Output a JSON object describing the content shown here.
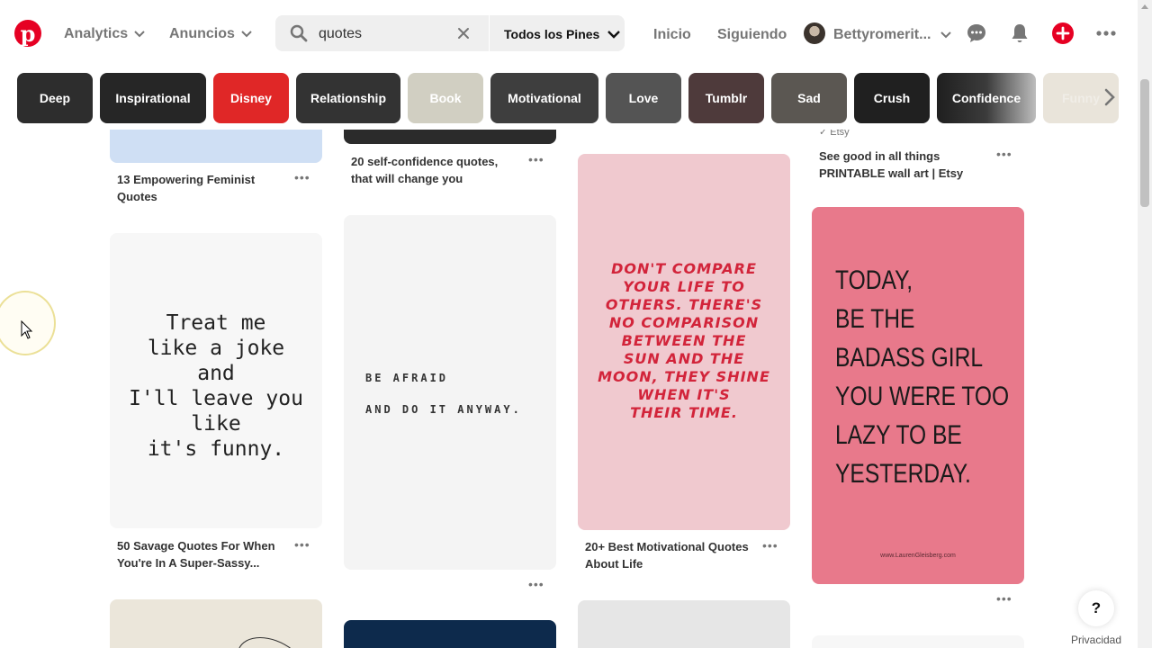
{
  "header": {
    "nav": [
      {
        "label": "Analytics"
      },
      {
        "label": "Anuncios"
      }
    ],
    "search": {
      "query": "quotes",
      "filter": "Todos los Pines"
    },
    "links": [
      {
        "label": "Inicio"
      },
      {
        "label": "Siguiendo"
      }
    ],
    "user": {
      "name": "Bettyromerit..."
    },
    "brand_color": "#e60023"
  },
  "chips": [
    {
      "label": "Deep",
      "color": "#2d2d2d"
    },
    {
      "label": "Inspirational",
      "color": "#262626"
    },
    {
      "label": "Disney",
      "color": "#e02727"
    },
    {
      "label": "Relationship",
      "color": "#333333"
    },
    {
      "label": "Book",
      "color": "#d1cfc2"
    },
    {
      "label": "Motivational",
      "color": "#3e3e3e"
    },
    {
      "label": "Love",
      "color": "#545454"
    },
    {
      "label": "Tumblr",
      "color": "#4e3a3b"
    },
    {
      "label": "Sad",
      "color": "#5b5752"
    },
    {
      "label": "Crush",
      "color": "#202020"
    },
    {
      "label": "Confidence",
      "color": "#3a3a3a"
    },
    {
      "label": "Funny",
      "color": "#e9e4da"
    }
  ],
  "pins": {
    "col1_top_title": "13 Empowering Feminist Quotes",
    "col1_mid_title": "50 Savage Quotes For When You're In A Super-Sassy...",
    "col1_mid_quote": [
      "Treat me",
      "like a joke",
      "and",
      "I'll leave you",
      "like",
      "it's funny."
    ],
    "col2_top_title": "20 self-confidence quotes, that will change you",
    "col2_mid_quote": [
      "BE AFRAID",
      "AND DO IT ANYWAY."
    ],
    "col3_mid_quote": [
      "DON'T COMPARE",
      "YOUR LIFE TO",
      "OTHERS. THERE'S",
      "NO COMPARISON",
      "BETWEEN THE",
      "SUN AND THE",
      "MOON, THEY SHINE",
      "WHEN IT'S",
      "THEIR TIME."
    ],
    "col3_mid_title": "20+ Best Motivational Quotes About Life",
    "col4_top_source": "Etsy",
    "col4_top_title": "See good in all things PRINTABLE wall art | Etsy",
    "col4_mid_quote": [
      "TODAY,",
      "BE THE",
      "BADASS GIRL",
      "YOU WERE TOO",
      "LAZY TO BE",
      "YESTERDAY."
    ],
    "col4_mid_url": "www.LaurenGleisberg.com"
  },
  "footer": {
    "help": "?",
    "privacy": "Privacidad"
  }
}
